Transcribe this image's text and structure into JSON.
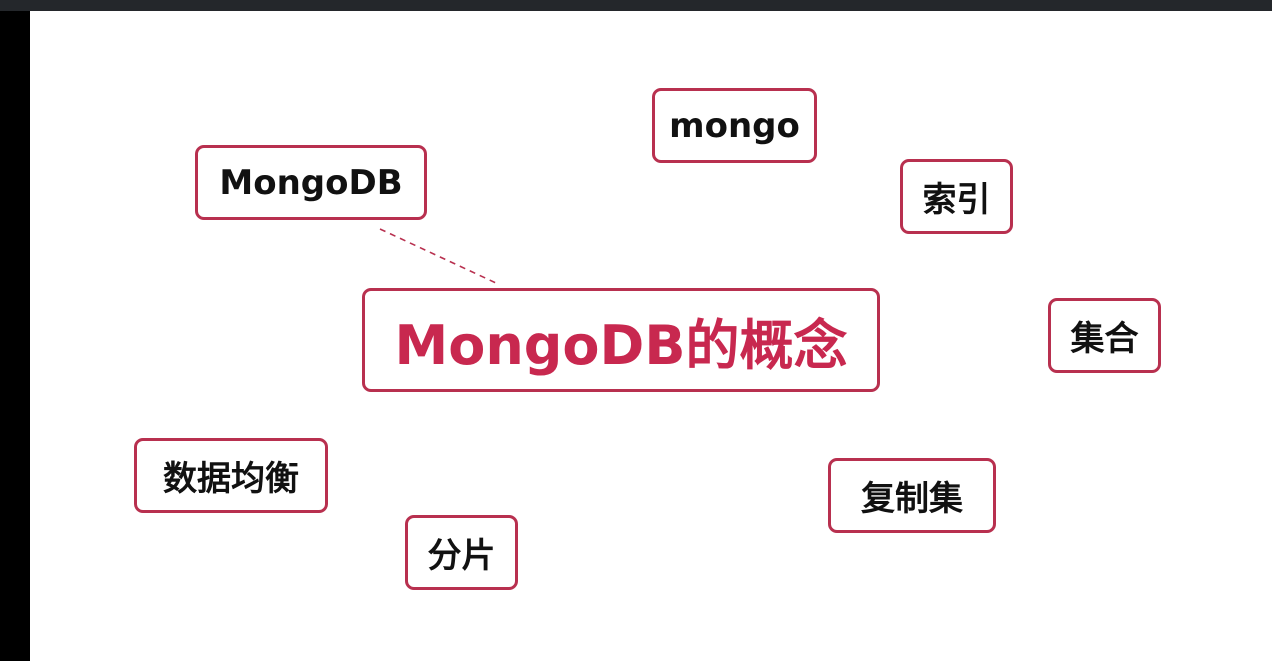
{
  "diagram": {
    "accent_color": "#b8304f",
    "center": {
      "label": "MongoDB的概念"
    },
    "nodes": [
      {
        "id": "mongodb",
        "label": "MongoDB"
      },
      {
        "id": "mongo",
        "label": "mongo"
      },
      {
        "id": "suoyin",
        "label": "索引"
      },
      {
        "id": "jihe",
        "label": "集合"
      },
      {
        "id": "shujujunheng",
        "label": "数据均衡"
      },
      {
        "id": "fenpian",
        "label": "分片"
      },
      {
        "id": "fuzhiji",
        "label": "复制集"
      }
    ],
    "connectors": [
      {
        "from": "mongodb",
        "to": "center",
        "style": "dashed"
      }
    ]
  }
}
